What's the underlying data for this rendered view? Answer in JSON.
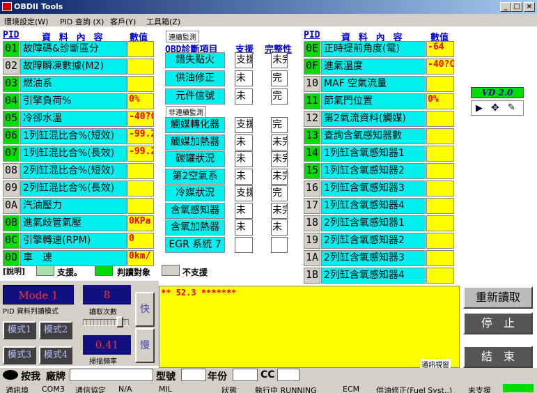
{
  "window": {
    "title": "OBDII Tools"
  },
  "menu": [
    "環境設定(W)",
    "PID 查詢 (X)",
    "客戶(Y)",
    "工具箱(Z)"
  ],
  "left": {
    "hdr_pid": "PID",
    "hdr_content": "資 料 內 容",
    "hdr_value": "數值",
    "rows": [
      {
        "pid": "01",
        "label": "故障碼&診斷區分",
        "value": ""
      },
      {
        "pid": "02",
        "label": "故障瞬凍數據(M2)",
        "value": ""
      },
      {
        "pid": "03",
        "label": "燃油系",
        "value": ""
      },
      {
        "pid": "04",
        "label": "引擎負荷%",
        "value": "0%"
      },
      {
        "pid": "05",
        "label": "冷卻水溫",
        "value": "-40?C"
      },
      {
        "pid": "06",
        "label": "1列缸混比合%(短效)",
        "value": "-99.2"
      },
      {
        "pid": "07",
        "label": "1列缸混比合%(長效)",
        "value": "-99.2"
      },
      {
        "pid": "08",
        "label": "2列缸混比合%(短效)",
        "value": ""
      },
      {
        "pid": "09",
        "label": "2列缸混比合%(長效)",
        "value": ""
      },
      {
        "pid": "0A",
        "label": "汽油壓力",
        "value": ""
      },
      {
        "pid": "0B",
        "label": "進氣歧管氣壓",
        "value": "0KPa"
      },
      {
        "pid": "0C",
        "label": "引擎轉速(RPM)",
        "value": "0"
      },
      {
        "pid": "0D",
        "label": "車　速",
        "value": "0km/"
      }
    ]
  },
  "legend": {
    "title": "[說明]",
    "supported": "支援。",
    "target": "判讀對象",
    "unsupported": "不支援"
  },
  "middle": {
    "cont_title": "連續監測",
    "hdr_item": "OBD診斷項目",
    "hdr_support": "支援",
    "hdr_complete": "完整性",
    "noncont_title": "非連續監測",
    "cont": [
      {
        "label": "錯失點火",
        "sup": "支援",
        "comp": "未完"
      },
      {
        "label": "供油修正",
        "sup": "未",
        "comp": "完"
      },
      {
        "label": "元件信號",
        "sup": "未",
        "comp": "完"
      }
    ],
    "noncont": [
      {
        "label": "觸媒轉化器",
        "sup": "支援",
        "comp": "完"
      },
      {
        "label": "觸媒加熱器",
        "sup": "未",
        "comp": "未完"
      },
      {
        "label": "碳罐狀況",
        "sup": "未",
        "comp": "未完"
      },
      {
        "label": "第2空氣系",
        "sup": "未",
        "comp": "未完"
      },
      {
        "label": "冷媒狀況",
        "sup": "支援",
        "comp": "完"
      },
      {
        "label": "含氧感知器",
        "sup": "未",
        "comp": "未完"
      },
      {
        "label": "含氧加熱器",
        "sup": "未",
        "comp": "未"
      },
      {
        "label": "EGR 系統 7",
        "sup": "",
        "comp": ""
      }
    ]
  },
  "right": {
    "hdr_pid": "PID",
    "hdr_content": "資 料 內 容",
    "hdr_value": "數值",
    "rows": [
      {
        "pid": "0E",
        "label": "正時提前角度(電)",
        "value": "-64"
      },
      {
        "pid": "0F",
        "label": "進氣溫度",
        "value": "-40?C"
      },
      {
        "pid": "10",
        "label": "MAF 空氣流量",
        "value": ""
      },
      {
        "pid": "11",
        "label": "節氣門位置",
        "value": "0%"
      },
      {
        "pid": "12",
        "label": "第2氣流資料(觸媒)",
        "value": ""
      },
      {
        "pid": "13",
        "label": "查詢含氧感知器數",
        "value": ""
      },
      {
        "pid": "14",
        "label": "1列缸含氧感知器1",
        "value": ""
      },
      {
        "pid": "15",
        "label": "1列缸含氧感知器2",
        "value": ""
      },
      {
        "pid": "16",
        "label": "1列缸含氧感知器3",
        "value": ""
      },
      {
        "pid": "17",
        "label": "1列缸含氧感知器4",
        "value": ""
      },
      {
        "pid": "18",
        "label": "2列缸含氧感知器1",
        "value": ""
      },
      {
        "pid": "19",
        "label": "2列缸含氧感知器2",
        "value": ""
      },
      {
        "pid": "1A",
        "label": "2列缸含氧感知器3",
        "value": ""
      },
      {
        "pid": "1B",
        "label": "2列缸含氧感知器4",
        "value": ""
      }
    ]
  },
  "vd": {
    "label": "VD 2.0"
  },
  "mode": {
    "label": "Mode 1",
    "caption": "PID 資料判讀模式",
    "b1": "模式1",
    "b2": "模式2",
    "b3": "模式3",
    "b4": "模式4"
  },
  "counter": {
    "value": "8",
    "label": "讀取次數",
    "fast": "快",
    "slow": "慢",
    "freq": "0.41",
    "freq_label": "掃描頻率"
  },
  "comm": {
    "text": "** 52.3 *******",
    "caption": "通訊視窗"
  },
  "actions": {
    "reread": "重新讀取",
    "stop": "停　止",
    "end": "結　束"
  },
  "info": {
    "press": "按我",
    "brand": "廠牌",
    "model": "型號",
    "year": "年份",
    "cc": "CC"
  },
  "status": [
    "通訊埠",
    "COM3",
    "通信協定",
    "N/A",
    "MIL",
    "",
    "狀態",
    "執行中 RUNNING",
    "ECM",
    "供油修正(Fuel Syst..)",
    "未支援"
  ],
  "colors": {
    "cyan": "#00f0f0",
    "yellow": "#ffff00",
    "green": "#00dd00",
    "lightgreen": "#aae0aa",
    "mode_blue": "#101080"
  }
}
